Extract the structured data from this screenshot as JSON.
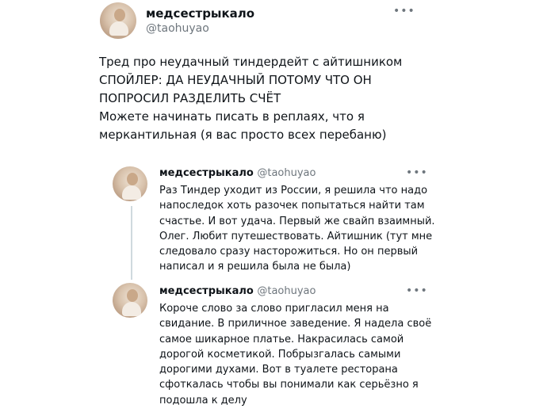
{
  "main_tweet": {
    "author_name": "медсестрыкало",
    "author_handle": "@taohuyao",
    "more_label": "•••",
    "lines": [
      "Тред про неудачный тиндердейт с айтишником",
      "СПОЙЛЕР: ДА НЕУДАЧНЫЙ ПОТОМУ ЧТО ОН",
      "ПОПРОСИЛ РАЗДЕЛИТЬ СЧЁТ",
      "Можете начинать писать в реплаях, что я",
      "меркантильная (я вас просто всех перебаню)"
    ]
  },
  "replies": [
    {
      "author_name": "медсестрыкало",
      "author_handle": "@taohuyao",
      "more_label": "•••",
      "lines": [
        "Раз Тиндер уходит из России, я решила что надо",
        "напоследок хоть разочек попытаться найти там",
        "счастье. И вот удача. Первый же свайп взаимный.",
        "Олег. Любит путешествовать. Айтишник (тут мне",
        "следовало сразу насторожиться. Но он первый",
        "написал и я решила была не была)"
      ]
    },
    {
      "author_name": "медсестрыкало",
      "author_handle": "@taohuyao",
      "more_label": "•••",
      "lines": [
        "Короче слово за слово пригласил меня на",
        "свидание. В приличное заведение. Я надела своё",
        "самое шикарное платье. Накрасилась самой",
        "дорогой косметикой. Побрызгалась самыми",
        "дорогими духами. Вот в туалете ресторана",
        "сфоткалась чтобы вы понимали как серьёзно я",
        "подошла к делу"
      ]
    }
  ]
}
